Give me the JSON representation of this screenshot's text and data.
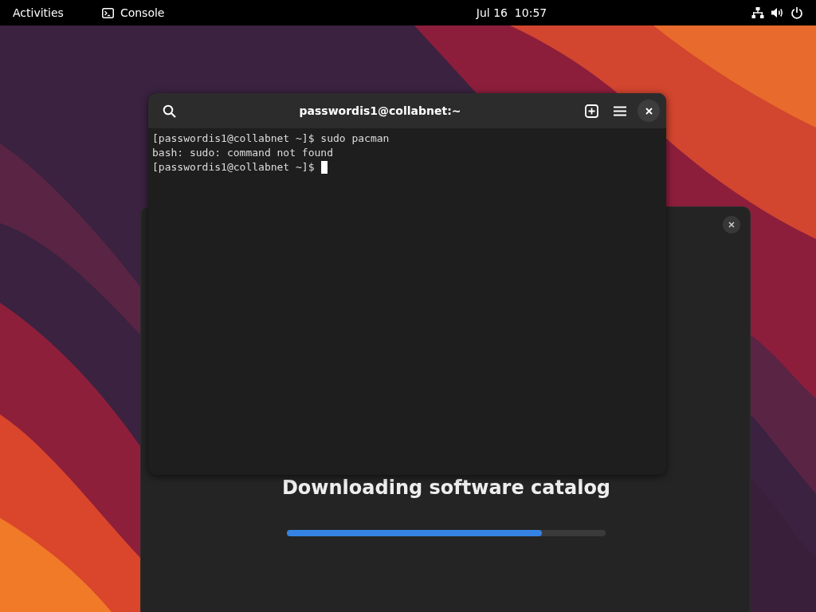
{
  "top_bar": {
    "activities": "Activities",
    "app": "Console",
    "clock": "Jul 16  10:57"
  },
  "software_window": {
    "heading": "Downloading software catalog",
    "progress": {
      "level": 0.8
    }
  },
  "terminal": {
    "title": "passwordis1@collabnet:~",
    "lines": [
      "[passwordis1@collabnet ~]$ sudo pacman",
      "bash: sudo: command not found"
    ],
    "prompt": "[passwordis1@collabnet ~]$"
  }
}
